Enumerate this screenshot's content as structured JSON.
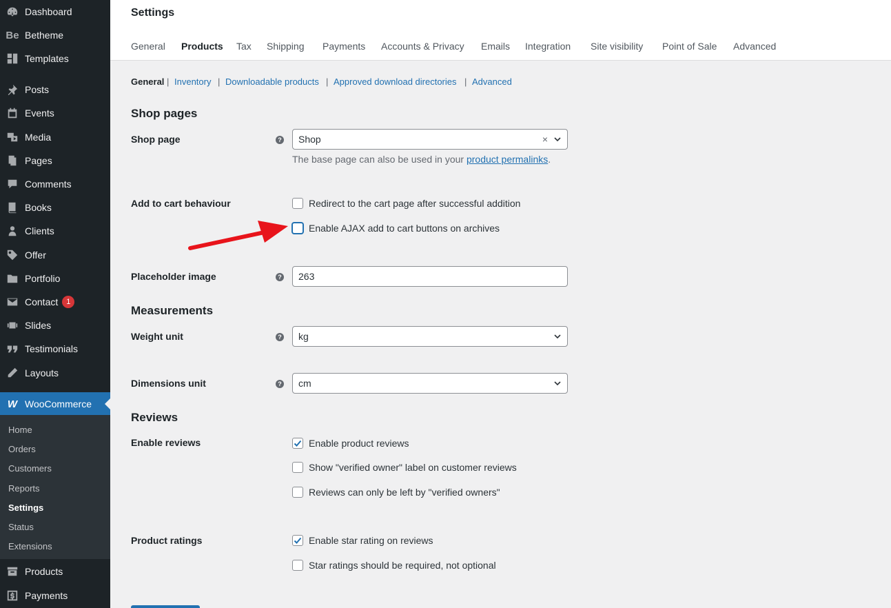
{
  "sidebar": {
    "items": [
      {
        "label": "Dashboard",
        "icon": "dashboard-icon"
      },
      {
        "label": "Betheme",
        "icon": "betheme-icon"
      },
      {
        "label": "Templates",
        "icon": "templates-icon"
      },
      {
        "label": "Posts",
        "icon": "pin-icon"
      },
      {
        "label": "Events",
        "icon": "calendar-icon"
      },
      {
        "label": "Media",
        "icon": "media-icon"
      },
      {
        "label": "Pages",
        "icon": "pages-icon"
      },
      {
        "label": "Comments",
        "icon": "comment-icon"
      },
      {
        "label": "Books",
        "icon": "book-icon"
      },
      {
        "label": "Clients",
        "icon": "user-icon"
      },
      {
        "label": "Offer",
        "icon": "tag-icon"
      },
      {
        "label": "Portfolio",
        "icon": "folder-icon"
      },
      {
        "label": "Contact",
        "icon": "mail-icon",
        "badge": "1"
      },
      {
        "label": "Slides",
        "icon": "slides-icon"
      },
      {
        "label": "Testimonials",
        "icon": "quote-icon"
      },
      {
        "label": "Layouts",
        "icon": "pencil-icon"
      },
      {
        "label": "WooCommerce",
        "icon": "woo-icon"
      },
      {
        "label": "Products",
        "icon": "archive-icon"
      },
      {
        "label": "Payments",
        "icon": "dollar-icon"
      }
    ],
    "woo_submenu": [
      "Home",
      "Orders",
      "Customers",
      "Reports",
      "Settings",
      "Status",
      "Extensions"
    ]
  },
  "header": {
    "title": "Settings",
    "tabs": [
      "General",
      "Products",
      "Tax",
      "Shipping",
      "Payments",
      "Accounts & Privacy",
      "Emails",
      "Integration",
      "Site visibility",
      "Point of Sale",
      "Advanced"
    ]
  },
  "subnav": [
    "General",
    "Inventory",
    "Downloadable products",
    "Approved download directories",
    "Advanced"
  ],
  "shop_pages": {
    "title": "Shop pages",
    "shop_page_label": "Shop page",
    "shop_page_value": "Shop",
    "shop_page_desc_prefix": "The base page can also be used in your",
    "shop_page_desc_link": "product permalinks",
    "add_to_cart_label": "Add to cart behaviour",
    "redirect_label": "Redirect to the cart page after successful addition",
    "ajax_label": "Enable AJAX add to cart buttons on archives",
    "placeholder_label": "Placeholder image",
    "placeholder_value": "263"
  },
  "measurements": {
    "title": "Measurements",
    "weight_label": "Weight unit",
    "weight_value": "kg",
    "dimensions_label": "Dimensions unit",
    "dimensions_value": "cm"
  },
  "reviews": {
    "title": "Reviews",
    "enable_label": "Enable reviews",
    "enable_product_reviews": "Enable product reviews",
    "verified_owner_label": "Show \"verified owner\" label on customer reviews",
    "verified_only": "Reviews can only be left by \"verified owners\"",
    "ratings_label": "Product ratings",
    "enable_star": "Enable star rating on reviews",
    "star_required": "Star ratings should be required, not optional"
  },
  "colors": {
    "accent": "#2271b1",
    "sidebar": "#1d2327",
    "arrow": "#e8141b"
  }
}
